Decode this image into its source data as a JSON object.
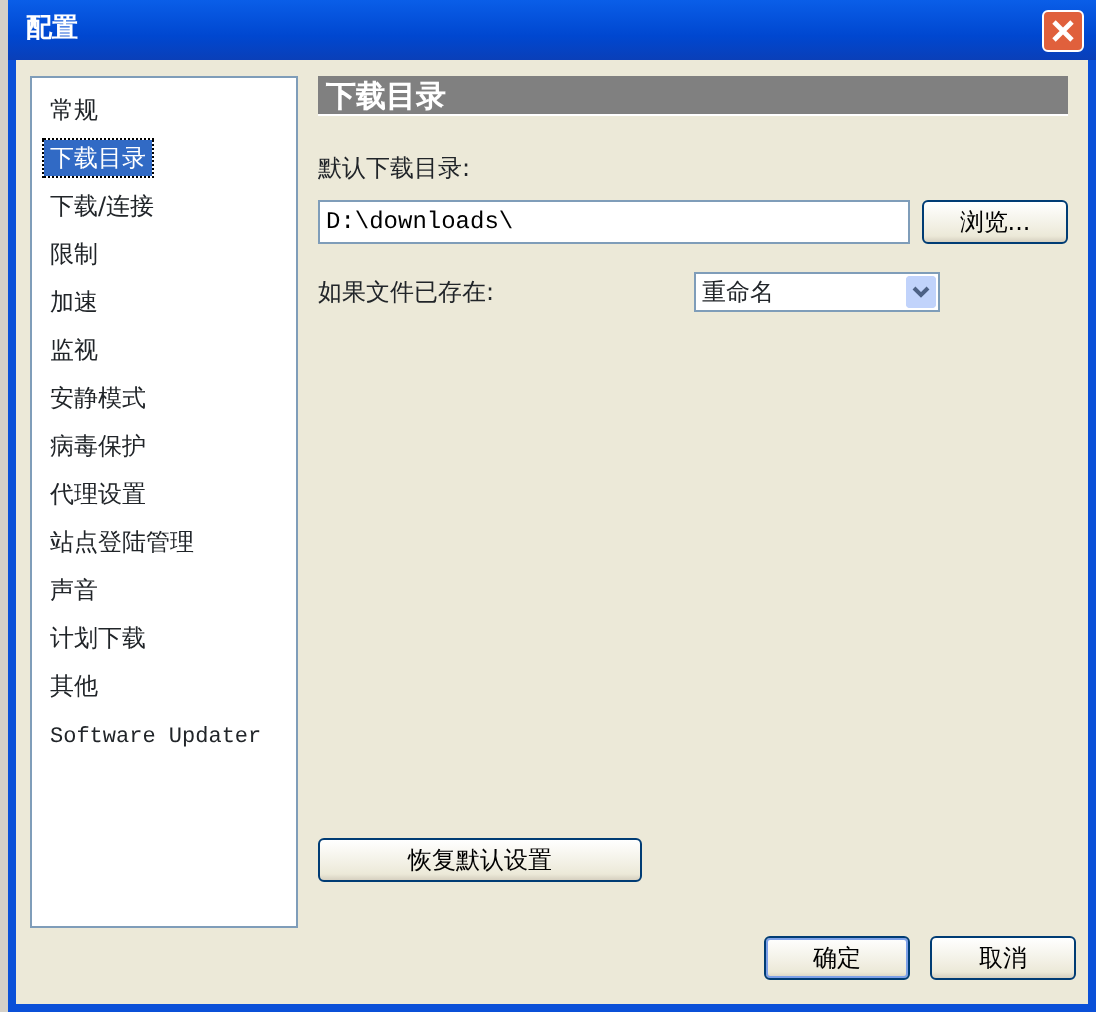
{
  "window": {
    "title": "配置"
  },
  "sidebar": {
    "items": [
      {
        "label": "常规",
        "selected": false
      },
      {
        "label": "下载目录",
        "selected": true
      },
      {
        "label": "下载/连接",
        "selected": false
      },
      {
        "label": "限制",
        "selected": false
      },
      {
        "label": "加速",
        "selected": false
      },
      {
        "label": "监视",
        "selected": false
      },
      {
        "label": "安静模式",
        "selected": false
      },
      {
        "label": "病毒保护",
        "selected": false
      },
      {
        "label": "代理设置",
        "selected": false
      },
      {
        "label": "站点登陆管理",
        "selected": false
      },
      {
        "label": "声音",
        "selected": false
      },
      {
        "label": "计划下载",
        "selected": false
      },
      {
        "label": "其他",
        "selected": false
      },
      {
        "label": "Software Updater",
        "selected": false
      }
    ]
  },
  "panel": {
    "header": "下载目录",
    "directory_label": "默认下载目录:",
    "directory_value": "D:\\downloads\\",
    "browse_button": "浏览...",
    "exists_label": "如果文件已存在:",
    "exists_value": "重命名",
    "restore_button": "恢复默认设置"
  },
  "buttons": [
    {
      "label": "确定",
      "default": true
    },
    {
      "label": "取消",
      "default": false
    }
  ]
}
